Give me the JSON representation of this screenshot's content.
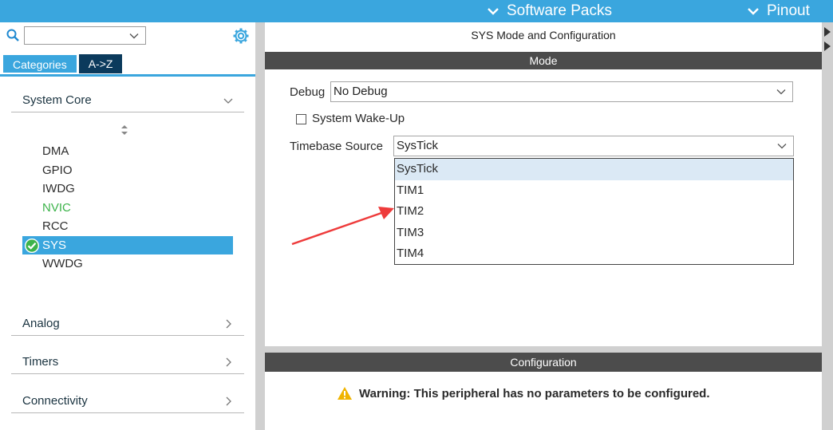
{
  "topbar": {
    "software_packs": "Software Packs",
    "pinout": "Pinout",
    "color": "#3aa6de"
  },
  "sidebar": {
    "search": {
      "value": ""
    },
    "tabs": [
      {
        "label": "Categories",
        "active": true
      },
      {
        "label": "A->Z",
        "active": false
      }
    ],
    "categories": [
      {
        "label": "System Core",
        "expanded": true
      },
      {
        "label": "Analog",
        "expanded": false
      },
      {
        "label": "Timers",
        "expanded": false
      },
      {
        "label": "Connectivity",
        "expanded": false
      }
    ],
    "peripherals": [
      {
        "label": "DMA",
        "state": "normal"
      },
      {
        "label": "GPIO",
        "state": "normal"
      },
      {
        "label": "IWDG",
        "state": "normal"
      },
      {
        "label": "NVIC",
        "state": "green"
      },
      {
        "label": "RCC",
        "state": "normal"
      },
      {
        "label": "SYS",
        "state": "selected"
      },
      {
        "label": "WWDG",
        "state": "normal"
      }
    ]
  },
  "main": {
    "title": "SYS Mode and Configuration",
    "mode_header": "Mode",
    "debug": {
      "label": "Debug",
      "value": "No Debug"
    },
    "wakeup": {
      "label": "System Wake-Up",
      "checked": false
    },
    "timebase": {
      "label": "Timebase Source",
      "value": "SysTick",
      "options": [
        "SysTick",
        "TIM1",
        "TIM2",
        "TIM3",
        "TIM4"
      ],
      "highlighted": "SysTick"
    },
    "config_header": "Configuration",
    "warning": "Warning: This peripheral has no parameters to be configured."
  },
  "colors": {
    "accent": "#3aa6de",
    "header_bar": "#4c4c4c",
    "annotation_arrow": "#ee3b3b",
    "green_item": "#3cb34a"
  }
}
